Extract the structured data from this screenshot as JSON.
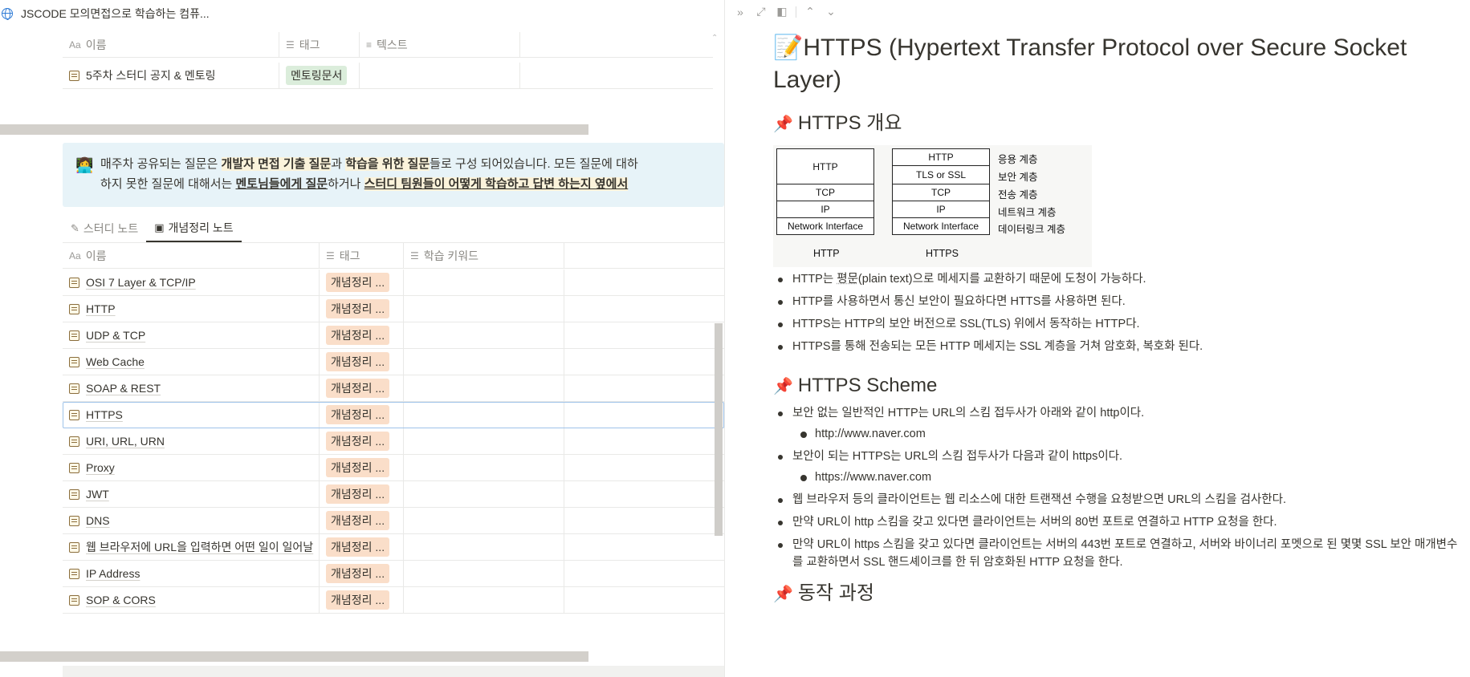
{
  "breadcrumb": {
    "title": "JSCODE 모의면접으로 학습하는 컴퓨..."
  },
  "db1": {
    "columns": [
      {
        "icon": "Aa",
        "label": "이름"
      },
      {
        "icon": "☰",
        "label": "태그"
      },
      {
        "icon": "≡",
        "label": "텍스트"
      }
    ],
    "rows": [
      {
        "name": "5주차 스터디 공지 & 멘토링",
        "tag": "멘토링문서"
      }
    ]
  },
  "callout": {
    "line1": {
      "a": "매주차 공유되는 질문은 ",
      "b": "개발자 면접 기출 질문",
      "c": "과 ",
      "d": "학습을 위한 질문",
      "e": "들로 구성 되어있습니다. 모든 질문에 대하"
    },
    "line2": {
      "a": "하지 못한 질문에 대해서는 ",
      "b": "멘토님들에게 질문",
      "c": "하거나 ",
      "d": "스터디 팀원들이 어떻게 학습하고 답변 하는지 옆에서"
    }
  },
  "tabs": [
    {
      "label": "스터디 노트",
      "active": false
    },
    {
      "label": "개념정리 노트",
      "active": true
    }
  ],
  "db2": {
    "columns": [
      {
        "icon": "Aa",
        "label": "이름"
      },
      {
        "icon": "☰",
        "label": "태그"
      },
      {
        "icon": "☰",
        "label": "학습 키워드"
      }
    ],
    "rows": [
      {
        "name": "OSI 7 Layer & TCP/IP",
        "tag": "개념정리 ..."
      },
      {
        "name": "HTTP",
        "tag": "개념정리 ..."
      },
      {
        "name": "UDP & TCP",
        "tag": "개념정리 ..."
      },
      {
        "name": "Web Cache",
        "tag": "개념정리 ..."
      },
      {
        "name": "SOAP & REST",
        "tag": "개념정리 ..."
      },
      {
        "name": "HTTPS",
        "tag": "개념정리 ...",
        "selected": true
      },
      {
        "name": "URI, URL, URN",
        "tag": "개념정리 ..."
      },
      {
        "name": "Proxy",
        "tag": "개념정리 ..."
      },
      {
        "name": "JWT",
        "tag": "개념정리 ..."
      },
      {
        "name": "DNS",
        "tag": "개념정리 ..."
      },
      {
        "name": "웹 브라우저에 URL을 입력하면 어떤 일이 일어날",
        "tag": "개념정리 ..."
      },
      {
        "name": "IP Address",
        "tag": "개념정리 ..."
      },
      {
        "name": "SOP & CORS",
        "tag": "개념정리 ..."
      }
    ]
  },
  "page": {
    "title": "HTTPS (Hypertext Transfer Protocol over Secure Socket Layer)",
    "sections": [
      {
        "heading": "HTTPS 개요",
        "diagram": {
          "http_stack": [
            "HTTP",
            "TCP",
            "IP",
            "Network Interface"
          ],
          "https_stack": [
            "HTTP",
            "TLS or SSL",
            "TCP",
            "IP",
            "Network Interface"
          ],
          "layers": [
            "응용 계층",
            "보안 계층",
            "전송 계층",
            "네트워크 계층",
            "데이터링크 계층"
          ],
          "captions": [
            "HTTP",
            "HTTPS"
          ]
        },
        "bullets": [
          {
            "pre": "HTTP는 ",
            "dotted": "평문",
            "post": "(plain text)으로 메세지를 교환하기 때문에 도청이 가능하다."
          },
          {
            "text": "HTTP를 사용하면서 통신 보안이 필요하다면 HTTS를 사용하면 된다."
          },
          {
            "text": "HTTPS는 HTTP의 보안 버전으로 SSL(TLS) 위에서 동작하는 HTTP다."
          },
          {
            "text": "HTTPS를 통해 전송되는 모든 HTTP 메세지는 SSL 계층을 거쳐 암호화, 복호화 된다."
          }
        ]
      },
      {
        "heading": "HTTPS Scheme",
        "bullets": [
          {
            "text": "보안 없는 일반적인 HTTP는 URL의 스킴 접두사가 아래와 같이 http이다.",
            "sub": "http://www.naver.com"
          },
          {
            "text": "보안이 되는 HTTPS는 URL의 스킴 접두사가 다음과 같이 https이다.",
            "sub": "https://www.naver.com"
          },
          {
            "text": "웹 브라우저 등의 클라이언트는 웹 리소스에 대한 트랜잭션 수행을 요청받으면 URL의 스킴을 검사한다."
          },
          {
            "text": "만약 URL이 http 스킴을 갖고 있다면 클라이언트는 서버의 80번 포트로 연결하고 HTTP 요청을 한다."
          },
          {
            "text": "만약 URL이 https 스킴을 갖고 있다면 클라이언트는 서버의 443번 포트로 연결하고, 서버와 바이너리 포멧으로 된 몇몇 SSL 보안 매개변수를 교환하면서 SSL 핸드셰이크를 한 뒤 암호화된 HTTP 요청을 한다."
          }
        ]
      },
      {
        "heading": "동작 과정"
      }
    ]
  }
}
